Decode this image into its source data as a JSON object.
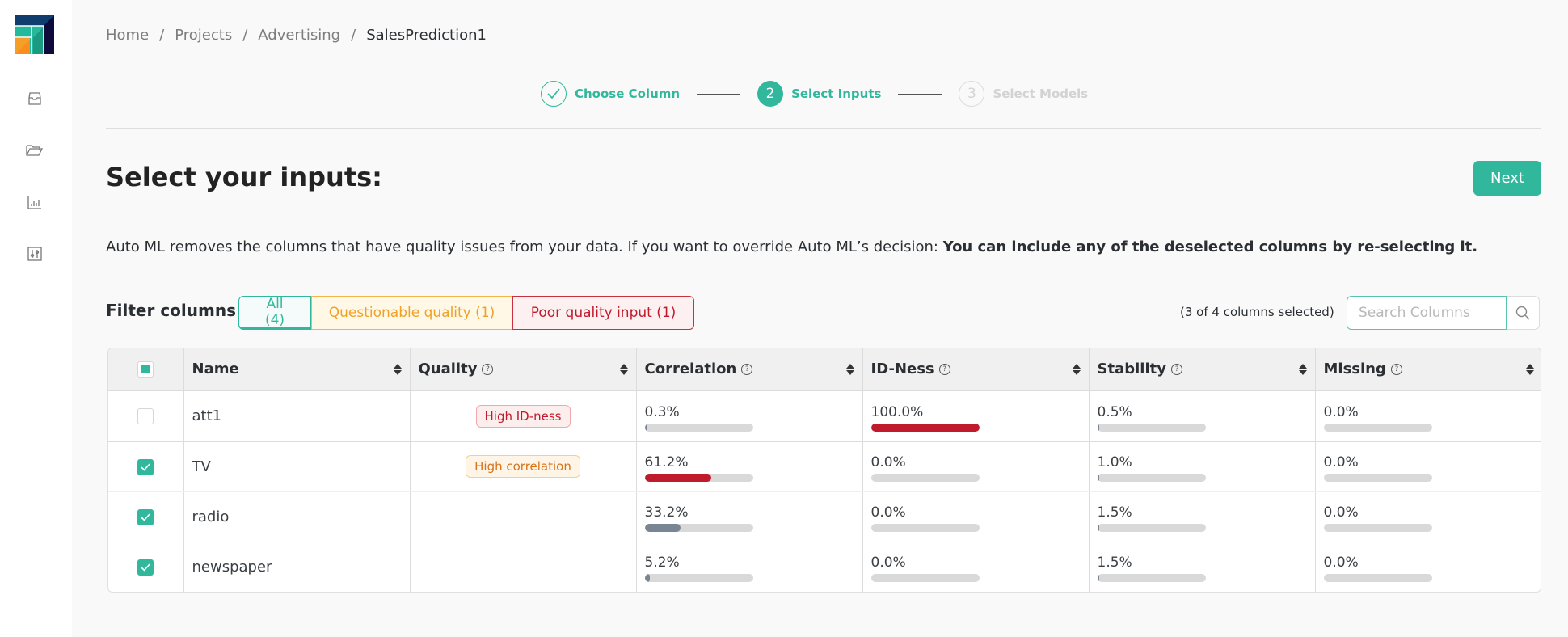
{
  "sidebar": {
    "items": [
      {
        "name": "inbox",
        "icon": "inbox-icon"
      },
      {
        "name": "projects",
        "icon": "folder-open-icon"
      },
      {
        "name": "analytics",
        "icon": "bar-chart-icon"
      },
      {
        "name": "settings",
        "icon": "sliders-icon"
      }
    ]
  },
  "breadcrumb": {
    "items": [
      "Home",
      "Projects",
      "Advertising"
    ],
    "current": "SalesPrediction1",
    "separator": "/"
  },
  "stepper": {
    "steps": [
      {
        "number": "1",
        "label": "Choose Column",
        "state": "done"
      },
      {
        "number": "2",
        "label": "Select Inputs",
        "state": "active"
      },
      {
        "number": "3",
        "label": "Select Models",
        "state": "pending"
      }
    ]
  },
  "page": {
    "title": "Select your inputs:",
    "next_label": "Next",
    "description_plain": "Auto ML removes the columns that have quality issues from your data. If you want to override Auto ML’s decision: ",
    "description_bold": "You can include any of the deselected columns by re-selecting it."
  },
  "filters": {
    "label": "Filter columns:",
    "all": "All (4)",
    "questionable": "Questionable quality (1)",
    "poor": "Poor quality input (1)"
  },
  "selection": {
    "count_text": "(3 of 4 columns selected)",
    "search_placeholder": "Search Columns",
    "search_value": ""
  },
  "table": {
    "headers": {
      "name": "Name",
      "quality": "Quality",
      "correlation": "Correlation",
      "idness": "ID-Ness",
      "stability": "Stability",
      "missing": "Missing"
    },
    "select_all_state": "partial",
    "rows": [
      {
        "checked": false,
        "name": "att1",
        "quality": "High ID-ness",
        "quality_level": "poor",
        "correlation": "0.3%",
        "correlation_pct": 0.3,
        "correlation_color": "tick",
        "idness": "100.0%",
        "idness_pct": 100,
        "idness_color": "red",
        "stability": "0.5%",
        "stability_pct": 0.5,
        "stability_color": "tick",
        "missing": "0.0%",
        "missing_pct": 0,
        "missing_color": "none"
      },
      {
        "checked": true,
        "name": "TV",
        "quality": "High correlation",
        "quality_level": "questionable",
        "correlation": "61.2%",
        "correlation_pct": 61.2,
        "correlation_color": "red",
        "idness": "0.0%",
        "idness_pct": 0,
        "idness_color": "none",
        "stability": "1.0%",
        "stability_pct": 1.0,
        "stability_color": "tick",
        "missing": "0.0%",
        "missing_pct": 0,
        "missing_color": "none"
      },
      {
        "checked": true,
        "name": "radio",
        "quality": "",
        "quality_level": "",
        "correlation": "33.2%",
        "correlation_pct": 33.2,
        "correlation_color": "gray",
        "idness": "0.0%",
        "idness_pct": 0,
        "idness_color": "none",
        "stability": "1.5%",
        "stability_pct": 1.5,
        "stability_color": "tick",
        "missing": "0.0%",
        "missing_pct": 0,
        "missing_color": "none"
      },
      {
        "checked": true,
        "name": "newspaper",
        "quality": "",
        "quality_level": "",
        "correlation": "5.2%",
        "correlation_pct": 5.2,
        "correlation_color": "gray",
        "idness": "0.0%",
        "idness_pct": 0,
        "idness_color": "none",
        "stability": "1.5%",
        "stability_pct": 1.5,
        "stability_color": "tick",
        "missing": "0.0%",
        "missing_pct": 0,
        "missing_color": "none"
      }
    ]
  },
  "colors": {
    "accent": "#31b89c",
    "warning": "#f0a227",
    "danger": "#c01b2d",
    "bar_red": "#c01b2d",
    "bar_gray": "#7a8593",
    "bar_track": "#d9d9d9"
  }
}
